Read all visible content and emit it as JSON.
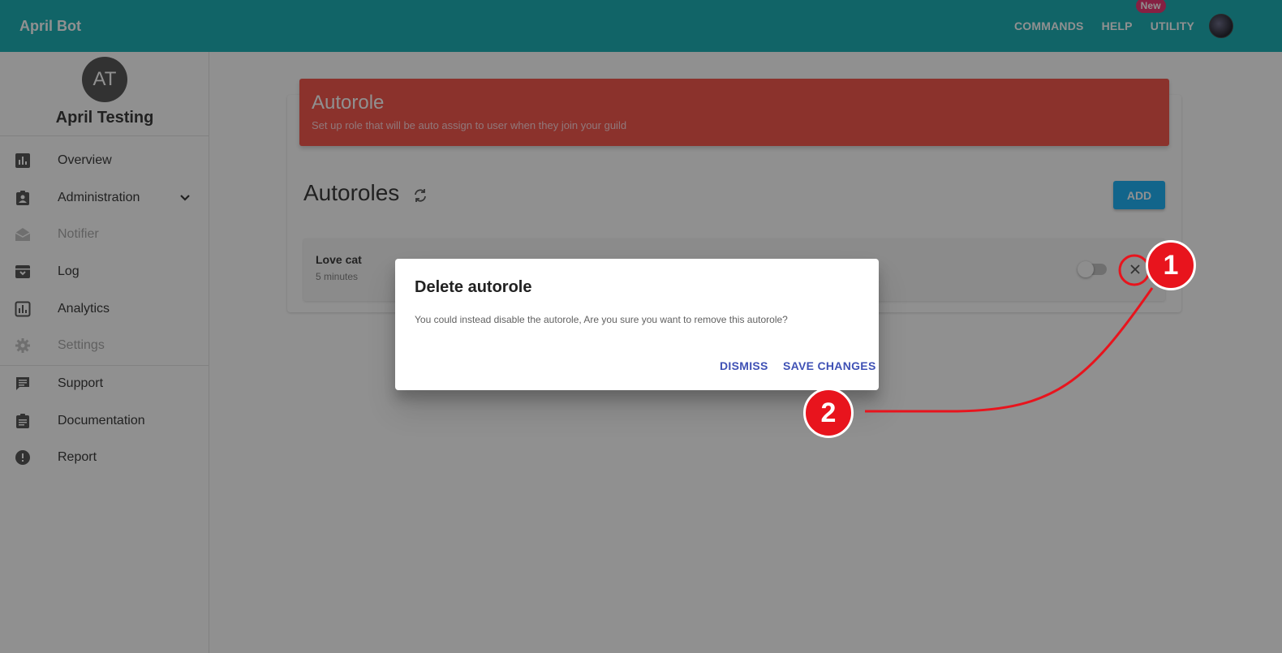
{
  "header": {
    "title": "April Bot",
    "nav": [
      {
        "label": "COMMANDS"
      },
      {
        "label": "HELP"
      },
      {
        "label": "UTILITY"
      }
    ],
    "new_badge": "New"
  },
  "sidebar": {
    "guild_initials": "AT",
    "guild_name": "April Testing",
    "items": [
      {
        "label": "Overview",
        "icon": "bar-chart-icon",
        "disabled": false
      },
      {
        "label": "Administration",
        "icon": "clipboard-account-icon",
        "disabled": false
      },
      {
        "label": "Notifier",
        "icon": "email-open-icon",
        "disabled": true
      },
      {
        "label": "Log",
        "icon": "archive-icon",
        "disabled": false
      },
      {
        "label": "Analytics",
        "icon": "analytics-icon",
        "disabled": false
      },
      {
        "label": "Settings",
        "icon": "gear-icon",
        "disabled": true
      },
      {
        "label": "Support",
        "icon": "message-icon",
        "disabled": false
      },
      {
        "label": "Documentation",
        "icon": "clipboard-text-icon",
        "disabled": false
      },
      {
        "label": "Report",
        "icon": "alert-circle-icon",
        "disabled": false
      }
    ]
  },
  "main": {
    "banner_title": "Autorole",
    "banner_subtitle": "Set up role that will be auto assign to user when they join your guild",
    "section_title": "Autoroles",
    "add_label": "ADD",
    "roles": [
      {
        "name": "Love cat",
        "time": "5 minutes",
        "enabled": false
      }
    ]
  },
  "dialog": {
    "title": "Delete autorole",
    "text": "You could instead disable the autorole, Are you sure you want to remove this autorole?",
    "dismiss_label": "DISMISS",
    "save_label": "SAVE CHANGES"
  },
  "annotations": {
    "step1": "1",
    "step2": "2"
  },
  "colors": {
    "topbar": "#00a6ad",
    "banner": "#f44336",
    "accent": "#03a9f4",
    "dialog_button": "#3f51b5",
    "annotation": "#e8141d"
  }
}
